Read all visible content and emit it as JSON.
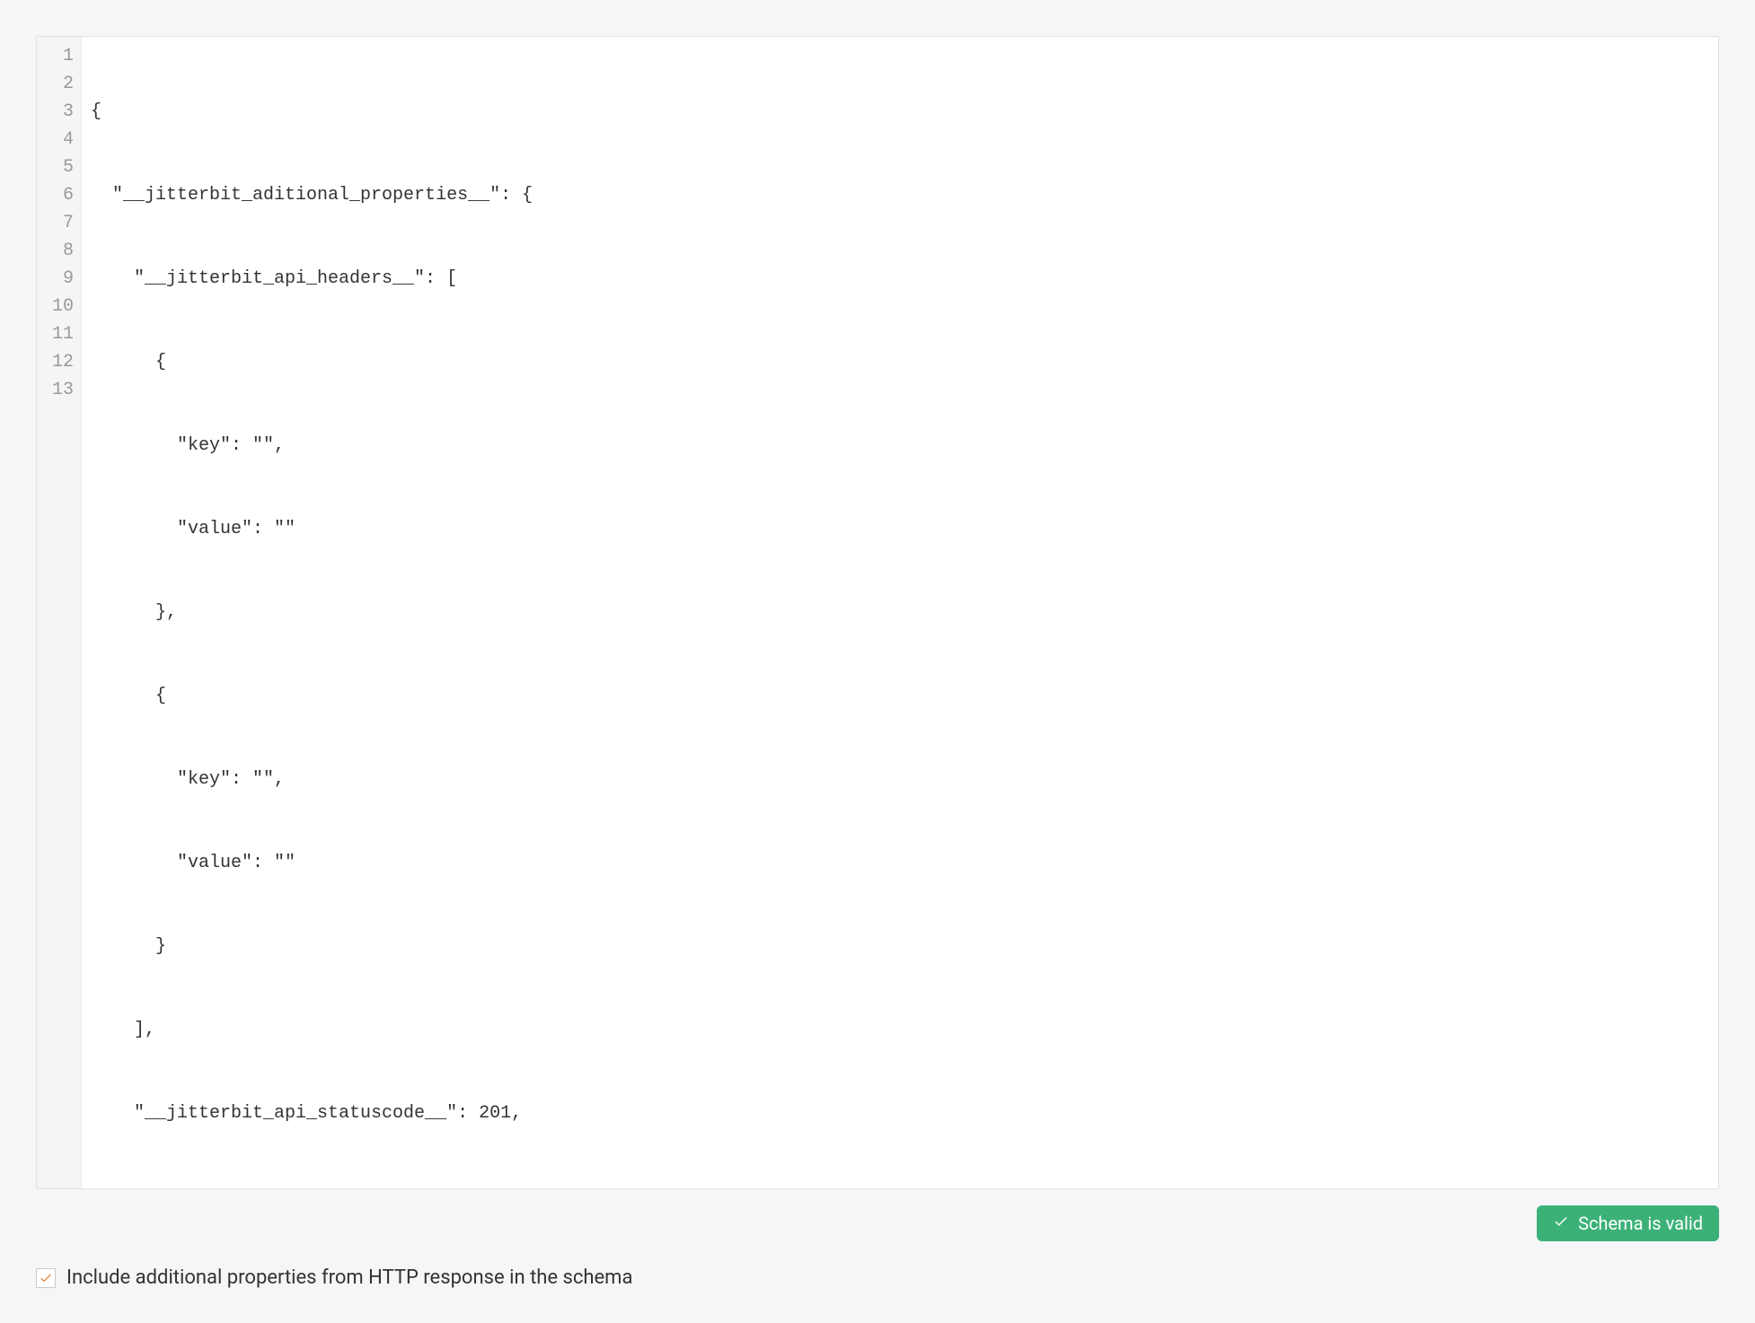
{
  "editor": {
    "line_numbers": [
      "1",
      "2",
      "3",
      "4",
      "5",
      "6",
      "7",
      "8",
      "9",
      "10",
      "11",
      "12",
      "13"
    ],
    "lines": [
      "{",
      "  \"__jitterbit_aditional_properties__\": {",
      "    \"__jitterbit_api_headers__\": [",
      "      {",
      "        \"key\": \"\",",
      "        \"value\": \"\"",
      "      },",
      "      {",
      "        \"key\": \"\",",
      "        \"value\": \"\"",
      "      }",
      "    ],",
      "    \"__jitterbit_api_statuscode__\": 201,"
    ]
  },
  "status": {
    "label": "Schema is valid"
  },
  "checkbox": {
    "checked": true,
    "label": "Include additional properties from HTTP response in the schema"
  }
}
